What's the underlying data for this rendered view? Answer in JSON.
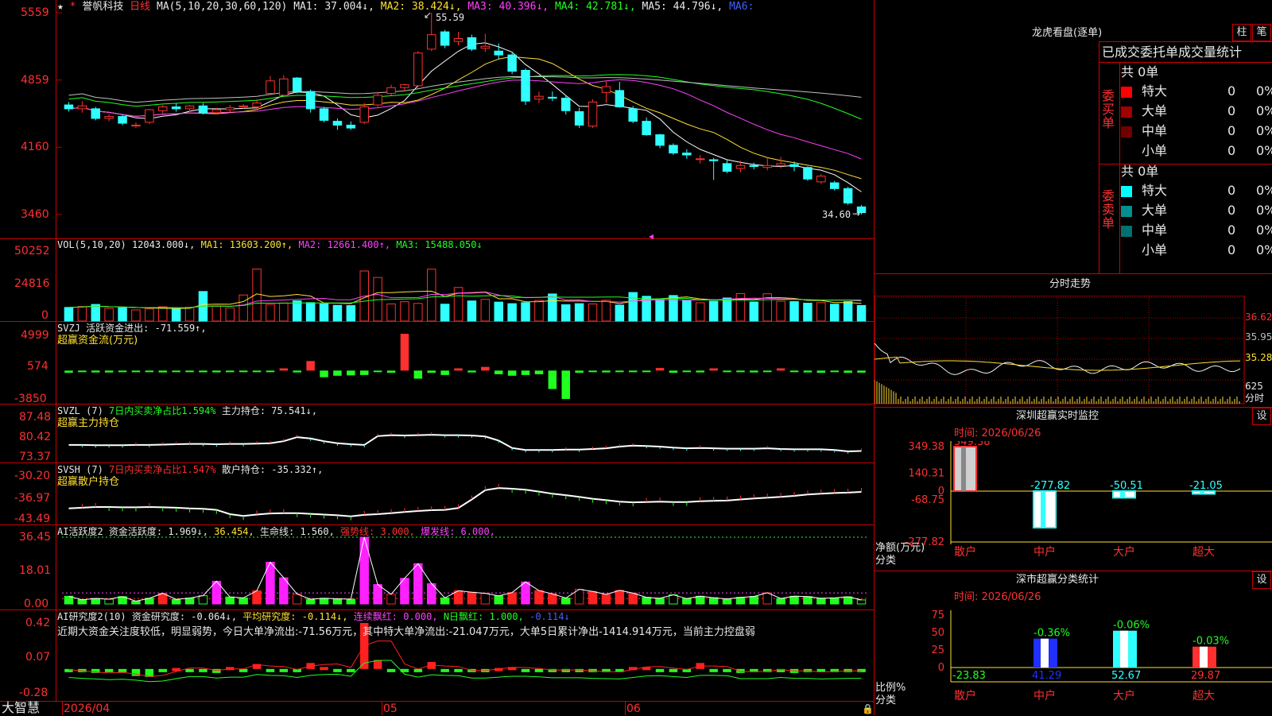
{
  "colors": {
    "up": "#ff3030",
    "down": "#30ffff",
    "ma1": "#ffffff",
    "ma2": "#ffe030",
    "ma3": "#ff40ff",
    "ma4": "#20ff20",
    "ma5": "#c0c0c0",
    "grid": "#b00000"
  },
  "header": {
    "star": "★",
    "marker": "*",
    "stock_name": "誉帆科技",
    "period": "日线",
    "ma_params": "MA(5,10,20,30,60,120)",
    "ma1": "MA1: 37.004↓,",
    "ma2": "MA2: 38.424↓,",
    "ma3": "MA3: 40.396↓,",
    "ma4": "MA4: 42.781↓,",
    "ma5": "MA5: 44.796↓,",
    "ma6": "MA6:"
  },
  "price_axis": [
    "5559",
    "4859",
    "4160",
    "3460"
  ],
  "price_annotations": {
    "high": "55.59",
    "low": "34.60"
  },
  "vol": {
    "title": "VOL(5,10,20)",
    "vol": "12043.000↓,",
    "ma1": "MA1: 13603.200↑,",
    "ma2": "MA2: 12661.400↑,",
    "ma3": "MA3: 15488.050↓",
    "axis": [
      "50252",
      "24816",
      "0"
    ]
  },
  "svzj": {
    "title": "SVZJ",
    "text": "活跃资金进出: -71.559↑,",
    "subtitle": "超赢资金流(万元)",
    "axis": [
      "4999",
      "574",
      "-3850"
    ]
  },
  "svzl": {
    "title": "SVZL (7)",
    "text1": "7日内买卖净占比1.594%",
    "text2": "主力持仓: 75.541↓,",
    "subtitle": "超赢主力持仓",
    "axis": [
      "87.48",
      "80.42",
      "73.37"
    ]
  },
  "svsh": {
    "title": "SVSH (7)",
    "text1": "7日内买卖净占比1.547%",
    "text2": "散户持仓: -35.332↑,",
    "subtitle": "超赢散户持仓",
    "axis": [
      "-30.20",
      "-36.97",
      "-43.49"
    ]
  },
  "ai_active": {
    "title": "AI活跃度2",
    "t1": "资金活跃度: 1.969↓,",
    "t2": "36.454,",
    "t3": "生命线: 1.560,",
    "t4": "强势线: 3.000,",
    "t5": "爆发线: 6.000,",
    "axis": [
      "36.45",
      "18.01",
      "0.00"
    ]
  },
  "ai_research": {
    "title": "AI研究度2(10)",
    "t1": "资金研究度: -0.064↓,",
    "t2": "平均研究度: -0.114↓,",
    "t3": "连续飘红: 0.000,",
    "t4": "N日飘红: 1.000,",
    "t5": "-0.114↓",
    "comment": "近期大资金关注度较低，明显弱势，今日大单净流出:-71.56万元，其中特大单净流出:-21.047万元，大单5日累计净出-1414.914万元，当前主力控盘弱",
    "axis": [
      "0.42",
      "0.07",
      "-0.28"
    ]
  },
  "footer": {
    "brand": "大智慧",
    "dates": [
      "2026/04",
      "05",
      "06"
    ]
  },
  "dragon": {
    "title": "龙虎看盘(逐单)",
    "btn_bar": "柱",
    "btn_pen": "笔",
    "heading": "已成交委托单成交量统计",
    "buy": {
      "label": "委买单",
      "total": "共 0单",
      "rows": [
        {
          "name": "特大",
          "val": "0",
          "pct": "0%",
          "color": "#ff0000"
        },
        {
          "name": "大单",
          "val": "0",
          "pct": "0%",
          "color": "#a00000"
        },
        {
          "name": "中单",
          "val": "0",
          "pct": "0%",
          "color": "#700000"
        },
        {
          "name": "小单",
          "val": "0",
          "pct": "0%",
          "color": "#000000"
        }
      ]
    },
    "sell": {
      "label": "委卖单",
      "total": "共 0单",
      "rows": [
        {
          "name": "特大",
          "val": "0",
          "pct": "0%",
          "color": "#00ffff"
        },
        {
          "name": "大单",
          "val": "0",
          "pct": "0%",
          "color": "#009090"
        },
        {
          "name": "中单",
          "val": "0",
          "pct": "0%",
          "color": "#007070"
        },
        {
          "name": "小单",
          "val": "0",
          "pct": "0%",
          "color": "#000000"
        }
      ]
    }
  },
  "intraday": {
    "title": "分时走势",
    "axis": [
      "36.62",
      "35.95",
      "35.28",
      "625"
    ],
    "label": "分时"
  },
  "sz_monitor": {
    "title": "深圳超赢实时监控",
    "btn": "设",
    "time": "时间: 2026/06/26",
    "axis": [
      "349.38",
      "140.31",
      "0",
      "-68.75",
      "-277.82"
    ],
    "ylabel": "净额(万元)",
    "xlabel": "分类",
    "categories": [
      "散户",
      "中户",
      "大户",
      "超大"
    ],
    "values": [
      349.38,
      -277.82,
      -50.51,
      -21.05
    ],
    "labels": [
      "349.38",
      "-277.82",
      "-50.51",
      "-21.05"
    ]
  },
  "sh_stats": {
    "title": "深市超赢分类统计",
    "btn": "设",
    "time": "时间: 2026/06/26",
    "axis": [
      "75",
      "50",
      "25",
      "0"
    ],
    "ylabel": "比例%",
    "xlabel": "分类",
    "categories": [
      "散户",
      "中户",
      "大户",
      "超大"
    ],
    "values": [
      -23.83,
      41.29,
      52.67,
      29.87
    ],
    "bottom_labels": [
      "-23.83",
      "41.29",
      "52.67",
      "29.87"
    ],
    "top_labels": [
      "",
      "-0.36%",
      "-0.06%",
      "-0.03%"
    ]
  },
  "chart_data": {
    "type": "candlestick",
    "ylim": [
      34.6,
      55.59
    ],
    "candles": [
      [
        46.0,
        46.3,
        45.3,
        45.6
      ],
      [
        45.6,
        46.4,
        45.2,
        45.9
      ],
      [
        45.6,
        45.8,
        44.4,
        44.6
      ],
      [
        44.6,
        45.0,
        44.3,
        44.8
      ],
      [
        44.8,
        45.0,
        43.9,
        44.1
      ],
      [
        43.9,
        44.2,
        43.6,
        43.9
      ],
      [
        44.2,
        45.6,
        44.0,
        45.5
      ],
      [
        45.4,
        46.0,
        45.1,
        45.8
      ],
      [
        45.8,
        46.2,
        45.3,
        45.6
      ],
      [
        45.6,
        46.0,
        45.3,
        45.9
      ],
      [
        45.9,
        46.2,
        45.0,
        45.2
      ],
      [
        45.2,
        45.7,
        45.0,
        45.5
      ],
      [
        45.5,
        46.0,
        45.2,
        45.7
      ],
      [
        45.8,
        46.1,
        45.6,
        45.9
      ],
      [
        45.8,
        46.6,
        45.5,
        46.2
      ],
      [
        47.2,
        49.0,
        47.0,
        48.5
      ],
      [
        47.0,
        49.1,
        46.9,
        48.7
      ],
      [
        48.8,
        48.9,
        47.2,
        47.4
      ],
      [
        47.4,
        47.6,
        45.2,
        45.6
      ],
      [
        45.6,
        45.8,
        44.2,
        44.4
      ],
      [
        44.3,
        44.6,
        43.4,
        43.9
      ],
      [
        43.9,
        44.3,
        43.4,
        43.6
      ],
      [
        44.2,
        46.2,
        44.0,
        45.8
      ],
      [
        46.0,
        47.3,
        45.8,
        47.0
      ],
      [
        47.2,
        48.1,
        47.0,
        47.8
      ],
      [
        47.8,
        48.2,
        47.4,
        48.1
      ],
      [
        48.0,
        51.6,
        47.8,
        51.4
      ],
      [
        51.8,
        55.59,
        51.6,
        53.3
      ],
      [
        53.6,
        53.8,
        51.9,
        52.2
      ],
      [
        52.6,
        53.6,
        52.2,
        52.9
      ],
      [
        53.0,
        53.3,
        51.6,
        51.8
      ],
      [
        51.9,
        53.4,
        51.5,
        52.1
      ],
      [
        51.6,
        52.4,
        50.8,
        51.2
      ],
      [
        51.2,
        51.4,
        49.2,
        49.5
      ],
      [
        49.6,
        49.8,
        46.0,
        46.4
      ],
      [
        46.6,
        47.4,
        46.2,
        46.9
      ],
      [
        46.8,
        47.4,
        46.4,
        46.7
      ],
      [
        46.7,
        47.0,
        45.0,
        45.4
      ],
      [
        45.3,
        45.7,
        43.6,
        43.9
      ],
      [
        43.8,
        46.6,
        43.6,
        46.3
      ],
      [
        47.3,
        48.5,
        46.2,
        47.9
      ],
      [
        47.5,
        48.4,
        45.7,
        45.8
      ],
      [
        45.6,
        45.9,
        44.1,
        44.3
      ],
      [
        44.3,
        44.7,
        42.8,
        42.9
      ],
      [
        42.9,
        43.0,
        41.5,
        41.8
      ],
      [
        41.8,
        42.0,
        40.8,
        41.0
      ],
      [
        41.0,
        41.4,
        40.4,
        40.8
      ],
      [
        40.4,
        40.8,
        39.9,
        40.4
      ],
      [
        40.3,
        40.5,
        38.2,
        40.2
      ],
      [
        39.9,
        40.3,
        38.9,
        39.1
      ],
      [
        39.4,
        40.2,
        39.0,
        39.7
      ],
      [
        39.7,
        40.0,
        39.3,
        39.6
      ],
      [
        39.5,
        40.6,
        39.2,
        39.7
      ],
      [
        39.7,
        40.6,
        39.4,
        39.9
      ],
      [
        39.8,
        40.1,
        39.1,
        39.6
      ],
      [
        39.5,
        39.6,
        38.1,
        38.3
      ],
      [
        38.0,
        38.8,
        37.8,
        38.6
      ],
      [
        37.9,
        38.1,
        37.1,
        37.3
      ],
      [
        37.3,
        37.5,
        35.6,
        35.8
      ],
      [
        35.4,
        35.6,
        34.6,
        34.8
      ]
    ],
    "volumes": [
      10500,
      11200,
      12800,
      9800,
      10100,
      8600,
      9400,
      11000,
      9500,
      10600,
      22800,
      11500,
      10200,
      20100,
      40100,
      12800,
      13900,
      15600,
      14200,
      13200,
      12100,
      11900,
      38600,
      33600,
      13200,
      14900,
      13600,
      40000,
      13000,
      25900,
      15500,
      16700,
      14600,
      13400,
      14200,
      15900,
      20900,
      12600,
      13400,
      13200,
      16000,
      12300,
      22000,
      19100,
      16500,
      19700,
      16000,
      14100,
      15300,
      17800,
      21200,
      14700,
      21000,
      15300,
      15000,
      13800,
      14200,
      13000,
      15000,
      12000
    ],
    "svzj": [
      -300,
      -200,
      -250,
      -260,
      -200,
      -220,
      -180,
      -250,
      -200,
      -210,
      -230,
      -240,
      -220,
      -200,
      -220,
      -210,
      300,
      -250,
      1300,
      -900,
      -700,
      -650,
      -600,
      -200,
      -300,
      4999,
      -1100,
      -300,
      -600,
      300,
      -250,
      500,
      -500,
      -700,
      -600,
      -500,
      -2500,
      -3850,
      -300,
      -200,
      -250,
      -200,
      -220,
      -200,
      350,
      -300,
      -200,
      -250,
      300,
      -200,
      -220,
      -250,
      -200,
      300,
      -200,
      -250,
      -300,
      -200,
      -300,
      -280
    ],
    "svzl": [
      78.1,
      78.1,
      78.0,
      78.0,
      78.0,
      78.1,
      78.1,
      78.2,
      78.3,
      78.4,
      78.4,
      78.3,
      78.4,
      78.4,
      78.5,
      78.6,
      79.2,
      80.4,
      80.0,
      79.2,
      78.6,
      78.3,
      78.1,
      80.7,
      81.0,
      80.9,
      81.0,
      81.1,
      81.0,
      81.0,
      80.9,
      80.6,
      79.4,
      77.2,
      76.6,
      76.6,
      76.6,
      76.7,
      76.7,
      76.9,
      77.1,
      77.6,
      77.9,
      77.8,
      77.6,
      77.3,
      77.1,
      77.2,
      77.1,
      77.0,
      77.0,
      77.0,
      77.1,
      76.9,
      76.8,
      76.8,
      76.8,
      76.6,
      76.2,
      76.3
    ],
    "svsh": [
      -39.9,
      -39.7,
      -39.5,
      -39.5,
      -39.6,
      -39.6,
      -39.5,
      -39.6,
      -39.7,
      -39.9,
      -40.0,
      -40.3,
      -41.5,
      -42.0,
      -41.6,
      -41.3,
      -41.2,
      -41.2,
      -41.4,
      -41.6,
      -41.8,
      -42.1,
      -41.7,
      -41.5,
      -41.2,
      -40.9,
      -40.6,
      -40.4,
      -40.3,
      -39.8,
      -37.4,
      -34.8,
      -34.2,
      -34.4,
      -34.7,
      -35.2,
      -35.8,
      -36.2,
      -36.7,
      -37.2,
      -37.6,
      -38.0,
      -38.2,
      -38.1,
      -38.0,
      -38.1,
      -38.1,
      -37.9,
      -37.8,
      -37.7,
      -37.4,
      -37.1,
      -36.9,
      -36.7,
      -36.4,
      -36.0,
      -35.8,
      -35.6,
      -35.5,
      -35.3
    ],
    "ai_active": [
      4.2,
      2.3,
      3.0,
      2.6,
      4.0,
      1.5,
      3.1,
      5.8,
      2.5,
      3.2,
      4.5,
      12.4,
      3.8,
      3.3,
      7.2,
      22.8,
      14.3,
      5.4,
      2.6,
      3.1,
      2.8,
      2.6,
      36.4,
      10.6,
      5.3,
      14.0,
      22.0,
      11.1,
      3.3,
      7.2,
      6.4,
      5.8,
      4.4,
      6.2,
      12.0,
      7.3,
      5.5,
      3.2,
      8.0,
      6.8,
      5.2,
      7.4,
      5.9,
      3.6,
      3.1,
      5.0,
      2.9,
      4.2,
      3.4,
      2.7,
      3.6,
      4.1,
      6.1,
      3.0,
      4.2,
      4.0,
      3.1,
      3.3,
      3.9,
      2.2
    ],
    "ai_research": [
      -0.05,
      -0.07,
      -0.08,
      -0.07,
      -0.06,
      -0.11,
      -0.12,
      -0.04,
      -0.03,
      -0.05,
      -0.04,
      -0.08,
      -0.02,
      -0.04,
      0.01,
      -0.05,
      -0.05,
      -0.05,
      0.02,
      -0.02,
      -0.04,
      -0.05,
      0.42,
      0.05,
      -0.05,
      -0.04,
      -0.05,
      0.03,
      -0.06,
      -0.06,
      -0.05,
      -0.06,
      -0.03,
      -0.02,
      -0.06,
      -0.05,
      -0.05,
      -0.06,
      -0.05,
      -0.07,
      -0.07,
      -0.06,
      -0.02,
      -0.02,
      -0.05,
      -0.05,
      -0.05,
      0.02,
      -0.05,
      -0.06,
      -0.08,
      -0.05,
      -0.06,
      -0.04,
      -0.08,
      -0.06,
      -0.06,
      -0.07,
      -0.05,
      -0.06
    ]
  }
}
